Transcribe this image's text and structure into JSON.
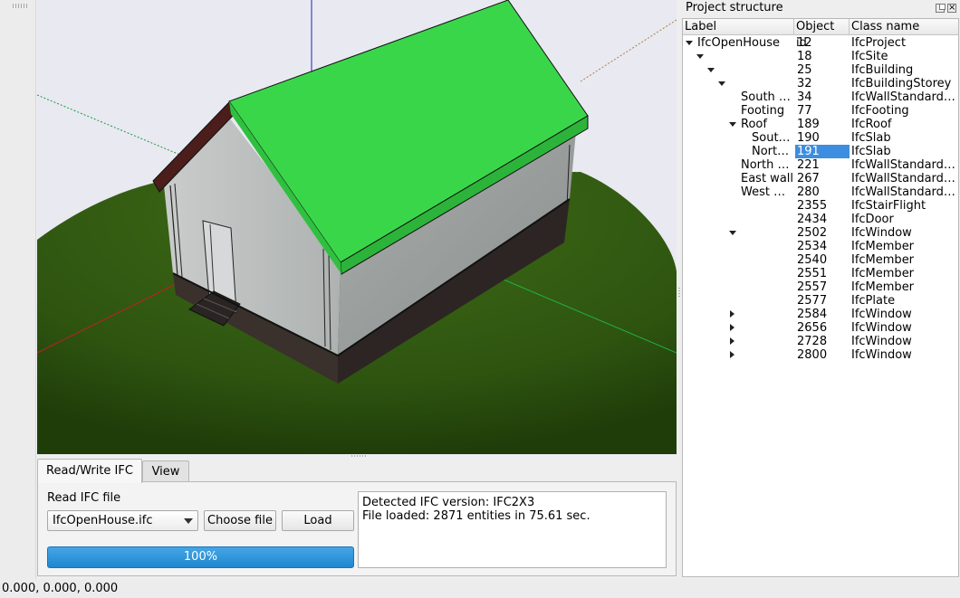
{
  "dock": {
    "title": "Project structure"
  },
  "tree": {
    "headers": {
      "label": "Label",
      "id": "Object id",
      "class": "Class name"
    },
    "rows": [
      {
        "label": "IfcOpenHouse",
        "id": "12",
        "cls": "IfcProject"
      },
      {
        "label": "",
        "id": "18",
        "cls": "IfcSite"
      },
      {
        "label": "",
        "id": "25",
        "cls": "IfcBuilding"
      },
      {
        "label": "",
        "id": "32",
        "cls": "IfcBuildingStorey"
      },
      {
        "label": "South wall",
        "id": "34",
        "cls": "IfcWallStandardCase"
      },
      {
        "label": "Footing",
        "id": "77",
        "cls": "IfcFooting"
      },
      {
        "label": "Roof",
        "id": "189",
        "cls": "IfcRoof"
      },
      {
        "label": "South roof",
        "id": "190",
        "cls": "IfcSlab"
      },
      {
        "label": "North roof",
        "id": "191",
        "cls": "IfcSlab"
      },
      {
        "label": "North wall",
        "id": "221",
        "cls": "IfcWallStandardCase"
      },
      {
        "label": "East wall",
        "id": "267",
        "cls": "IfcWallStandardCase"
      },
      {
        "label": "West wall",
        "id": "280",
        "cls": "IfcWallStandardCase"
      },
      {
        "label": "",
        "id": "2355",
        "cls": "IfcStairFlight"
      },
      {
        "label": "",
        "id": "2434",
        "cls": "IfcDoor"
      },
      {
        "label": "",
        "id": "2502",
        "cls": "IfcWindow"
      },
      {
        "label": "",
        "id": "2534",
        "cls": "IfcMember"
      },
      {
        "label": "",
        "id": "2540",
        "cls": "IfcMember"
      },
      {
        "label": "",
        "id": "2551",
        "cls": "IfcMember"
      },
      {
        "label": "",
        "id": "2557",
        "cls": "IfcMember"
      },
      {
        "label": "",
        "id": "2577",
        "cls": "IfcPlate"
      },
      {
        "label": "",
        "id": "2584",
        "cls": "IfcWindow"
      },
      {
        "label": "",
        "id": "2656",
        "cls": "IfcWindow"
      },
      {
        "label": "",
        "id": "2728",
        "cls": "IfcWindow"
      },
      {
        "label": "",
        "id": "2800",
        "cls": "IfcWindow"
      }
    ],
    "selected_id": "191"
  },
  "tabs": {
    "read_write": "Read/Write IFC",
    "view": "View"
  },
  "read_panel": {
    "label": "Read IFC file",
    "file_value": "IfcOpenHouse.ifc",
    "choose_label": "Choose file",
    "load_label": "Load",
    "progress_text": "100%",
    "progress_value": 100
  },
  "log": {
    "line1": "Detected IFC version: IFC2X3",
    "line2": "File loaded: 2871 entities in 75.61 sec."
  },
  "status": {
    "coords": "0.000, 0.000, 0.000"
  },
  "colors": {
    "background": "#e9e9f1",
    "roof": "#3ad64a",
    "terrain": "#3f6b17",
    "wall": "#b9bdbc",
    "footing": "#3a302c",
    "selection": "#3d8ee0",
    "progress": "#2f95da"
  }
}
